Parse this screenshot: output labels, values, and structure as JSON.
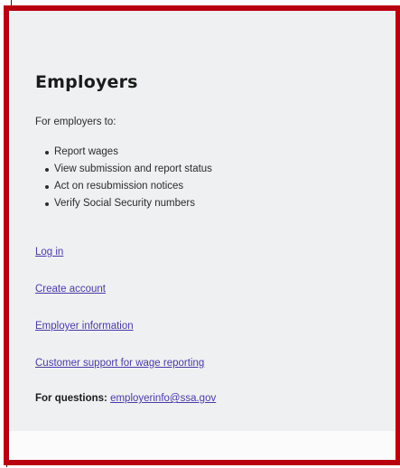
{
  "card": {
    "heading": "Employers",
    "intro": "For employers to:",
    "bullets": [
      "Report wages",
      "View submission and report status",
      "Act on resubmission notices",
      "Verify Social Security numbers"
    ],
    "links": {
      "login": "Log in",
      "create_account": "Create account",
      "employer_information": "Employer information",
      "customer_support": "Customer support for wage reporting"
    },
    "questions": {
      "label": "For questions:",
      "email": "employerinfo@ssa.gov"
    }
  },
  "colors": {
    "frame": "#b8000f",
    "card_background": "#eff0f2",
    "link": "#4a3aa8",
    "text": "#1b1b1b"
  }
}
